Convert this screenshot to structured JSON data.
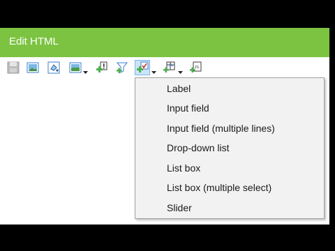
{
  "window": {
    "title": "Edit HTML",
    "accent_color": "#7cc342"
  },
  "toolbar": {
    "buttons": [
      {
        "name": "save-icon"
      },
      {
        "name": "image-icon"
      },
      {
        "name": "fill-color-icon"
      },
      {
        "name": "background-image-icon",
        "has_dropdown": true
      },
      {
        "name": "insert-field-icon"
      },
      {
        "name": "filter-icon"
      },
      {
        "name": "insert-form-control-icon",
        "has_dropdown": true,
        "active": true
      },
      {
        "name": "insert-table-icon",
        "has_dropdown": true
      },
      {
        "name": "insert-javascript-icon"
      }
    ]
  },
  "menu": {
    "items": [
      {
        "label": "Label"
      },
      {
        "label": "Input field"
      },
      {
        "label": "Input field (multiple lines)"
      },
      {
        "label": "Drop-down list"
      },
      {
        "label": "List box"
      },
      {
        "label": "List box (multiple select)"
      },
      {
        "label": "Slider"
      }
    ]
  }
}
